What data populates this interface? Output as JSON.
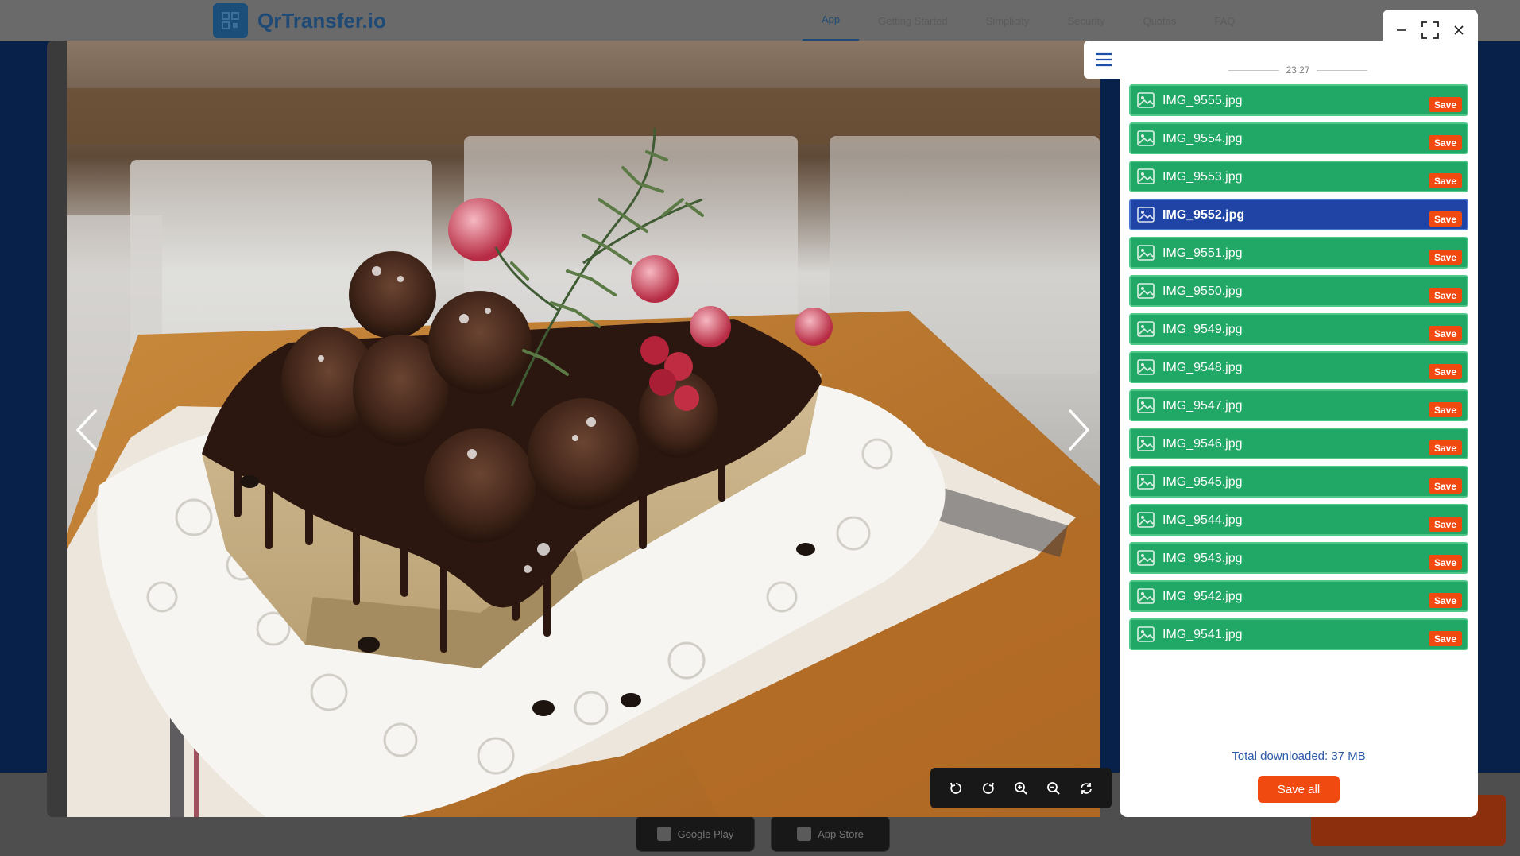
{
  "background": {
    "logo_text": "QrTransfer.io",
    "nav": [
      "App",
      "Getting Started",
      "Simplicity",
      "Security",
      "Quotas",
      "FAQ"
    ],
    "stores": [
      "Google Play",
      "App Store"
    ]
  },
  "viewer": {
    "prev_icon": "chevron-left-icon",
    "next_icon": "chevron-right-icon",
    "toolbar": [
      {
        "name": "rotate-left",
        "icon": "rotate-left-icon"
      },
      {
        "name": "rotate-right",
        "icon": "rotate-right-icon"
      },
      {
        "name": "zoom-in",
        "icon": "zoom-in-icon"
      },
      {
        "name": "zoom-out",
        "icon": "zoom-out-icon"
      },
      {
        "name": "reset",
        "icon": "reset-icon"
      }
    ]
  },
  "window_controls": {
    "minimize_icon": "minimize-icon",
    "fullscreen_icon": "fullscreen-icon",
    "close_icon": "close-icon"
  },
  "panel": {
    "menu_icon": "menu-icon",
    "timestamp": "23:27",
    "save_label": "Save",
    "selected": "IMG_9552.jpg",
    "files": [
      "IMG_9555.jpg",
      "IMG_9554.jpg",
      "IMG_9553.jpg",
      "IMG_9552.jpg",
      "IMG_9551.jpg",
      "IMG_9550.jpg",
      "IMG_9549.jpg",
      "IMG_9548.jpg",
      "IMG_9547.jpg",
      "IMG_9546.jpg",
      "IMG_9545.jpg",
      "IMG_9544.jpg",
      "IMG_9543.jpg",
      "IMG_9542.jpg",
      "IMG_9541.jpg"
    ],
    "total_downloaded": "Total downloaded: 37 MB",
    "save_all_label": "Save all"
  },
  "colors": {
    "file_green": "#21a866",
    "file_selected": "#2044a5",
    "save_orange": "#f04a10",
    "link_blue": "#2c5aa8"
  }
}
